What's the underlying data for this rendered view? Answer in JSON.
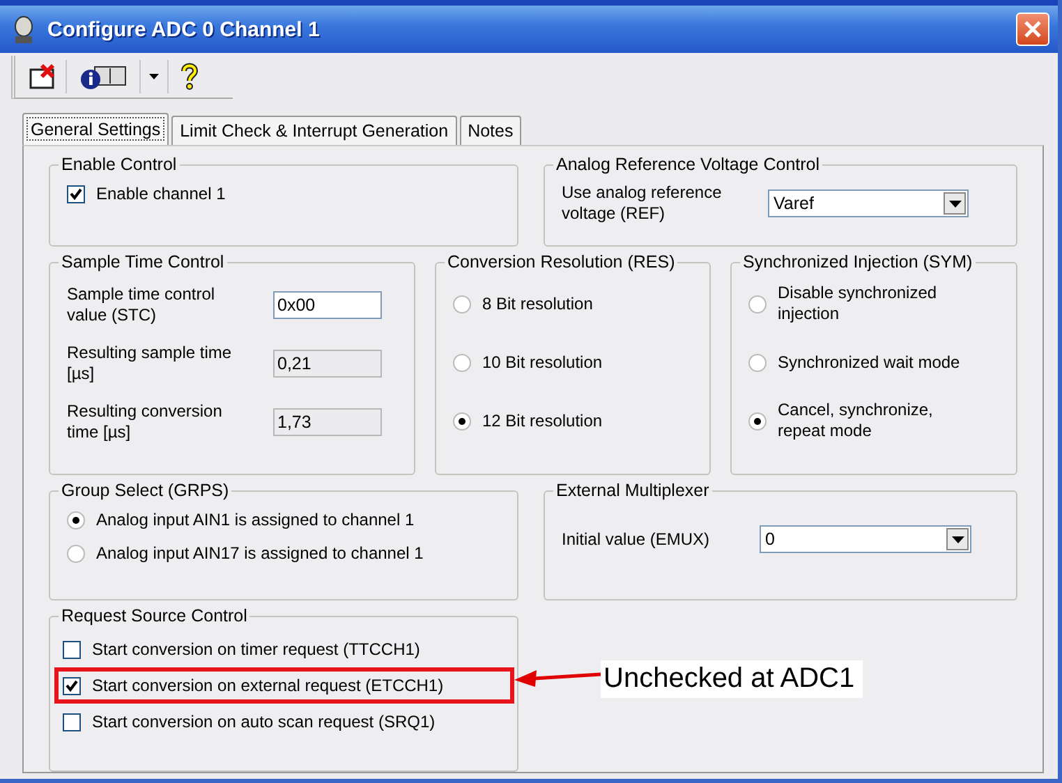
{
  "window": {
    "title": "Configure ADC 0 Channel 1"
  },
  "tabs": [
    {
      "label": "General Settings",
      "selected": true
    },
    {
      "label": "Limit Check & Interrupt Generation",
      "selected": false
    },
    {
      "label": "Notes",
      "selected": false
    }
  ],
  "enable_control": {
    "title": "Enable Control",
    "checkbox": {
      "label": "Enable channel 1",
      "checked": true
    }
  },
  "analog_reference": {
    "title": "Analog Reference Voltage Control",
    "label": "Use analog reference voltage (REF)",
    "value": "Varef"
  },
  "sample_time": {
    "title": "Sample Time Control",
    "fields": [
      {
        "label": "Sample time control value (STC)",
        "value": "0x00",
        "disabled": false
      },
      {
        "label": "Resulting sample time [µs]",
        "value": "0,21",
        "disabled": true
      },
      {
        "label": "Resulting conversion time [µs]",
        "value": "1,73",
        "disabled": true
      }
    ]
  },
  "conversion_resolution": {
    "title": "Conversion Resolution (RES)",
    "options": [
      {
        "label": "8 Bit resolution",
        "selected": false
      },
      {
        "label": "10 Bit resolution",
        "selected": false
      },
      {
        "label": "12 Bit resolution",
        "selected": true
      }
    ]
  },
  "synchronized_injection": {
    "title": "Synchronized Injection (SYM)",
    "options": [
      {
        "label": "Disable synchronized injection",
        "selected": false
      },
      {
        "label": "Synchronized wait mode",
        "selected": false
      },
      {
        "label": "Cancel, synchronize, repeat mode",
        "selected": true
      }
    ]
  },
  "group_select": {
    "title": "Group Select (GRPS)",
    "options": [
      {
        "label": "Analog input AIN1 is assigned to channel 1",
        "selected": true
      },
      {
        "label": "Analog input AIN17 is assigned to channel 1",
        "selected": false
      }
    ]
  },
  "external_multiplexer": {
    "title": "External Multiplexer",
    "label": "Initial value (EMUX)",
    "value": "0"
  },
  "request_source": {
    "title": "Request Source Control",
    "options": [
      {
        "label": "Start conversion on timer request (TTCCH1)",
        "checked": false,
        "highlighted": false
      },
      {
        "label": "Start conversion on external request (ETCCH1)",
        "checked": true,
        "highlighted": true
      },
      {
        "label": "Start conversion on auto scan request (SRQ1)",
        "checked": false,
        "highlighted": false
      }
    ]
  },
  "annotation": {
    "text": "Unchecked at ADC1"
  }
}
